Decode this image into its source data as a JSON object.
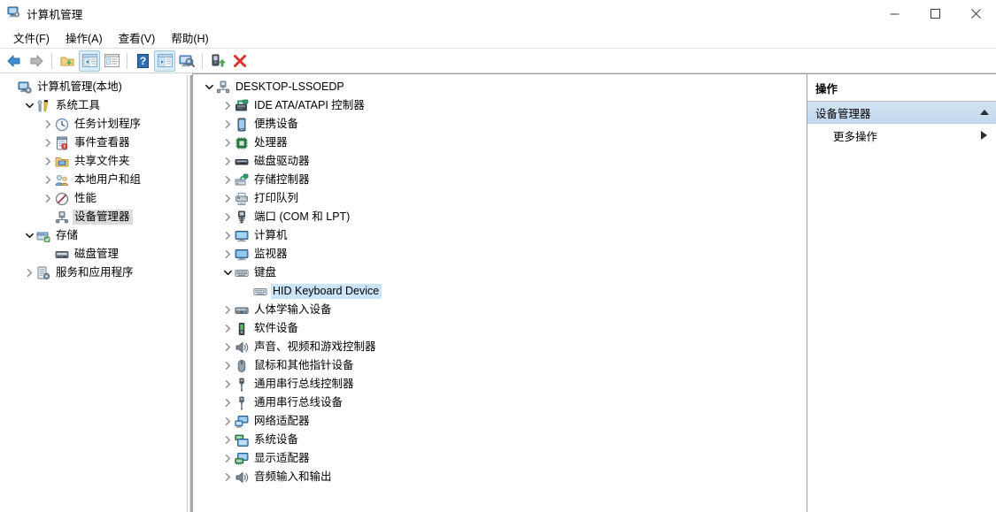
{
  "window": {
    "title": "计算机管理",
    "app_icon": "computer-management-icon",
    "controls": {
      "minimize": "minimize-icon",
      "maximize": "maximize-icon",
      "close": "close-icon"
    }
  },
  "menubar": {
    "items": [
      {
        "label": "文件(F)",
        "name": "menu-file"
      },
      {
        "label": "操作(A)",
        "name": "menu-action"
      },
      {
        "label": "查看(V)",
        "name": "menu-view"
      },
      {
        "label": "帮助(H)",
        "name": "menu-help"
      }
    ]
  },
  "toolbar": {
    "items": [
      {
        "icon": "back-arrow-icon",
        "active": false
      },
      {
        "icon": "forward-arrow-icon",
        "active": false
      },
      {
        "separator": true
      },
      {
        "icon": "up-folder-icon",
        "active": false
      },
      {
        "icon": "show-console-tree-icon",
        "active": true
      },
      {
        "icon": "properties-icon",
        "active": false
      },
      {
        "separator": true
      },
      {
        "icon": "help-icon",
        "active": false
      },
      {
        "icon": "show-action-pane-icon",
        "active": true
      },
      {
        "icon": "scan-hardware-icon",
        "active": false
      },
      {
        "separator": true
      },
      {
        "icon": "update-driver-icon",
        "active": false
      },
      {
        "icon": "uninstall-device-icon",
        "active": false
      }
    ]
  },
  "sidebar": {
    "items": [
      {
        "label": "计算机管理(本地)",
        "icon": "computer-management-icon",
        "indent": 0,
        "chevron": "none",
        "selected": false
      },
      {
        "label": "系统工具",
        "icon": "system-tools-icon",
        "indent": 1,
        "chevron": "expanded",
        "selected": false
      },
      {
        "label": "任务计划程序",
        "icon": "task-scheduler-icon",
        "indent": 2,
        "chevron": "collapsed",
        "selected": false
      },
      {
        "label": "事件查看器",
        "icon": "event-viewer-icon",
        "indent": 2,
        "chevron": "collapsed",
        "selected": false
      },
      {
        "label": "共享文件夹",
        "icon": "shared-folders-icon",
        "indent": 2,
        "chevron": "collapsed",
        "selected": false
      },
      {
        "label": "本地用户和组",
        "icon": "local-users-groups-icon",
        "indent": 2,
        "chevron": "collapsed",
        "selected": false
      },
      {
        "label": "性能",
        "icon": "performance-icon",
        "indent": 2,
        "chevron": "collapsed",
        "selected": false
      },
      {
        "label": "设备管理器",
        "icon": "device-manager-icon",
        "indent": 2,
        "chevron": "none",
        "selected": true
      },
      {
        "label": "存储",
        "icon": "storage-icon",
        "indent": 1,
        "chevron": "expanded",
        "selected": false
      },
      {
        "label": "磁盘管理",
        "icon": "disk-management-icon",
        "indent": 2,
        "chevron": "none",
        "selected": false
      },
      {
        "label": "服务和应用程序",
        "icon": "services-applications-icon",
        "indent": 1,
        "chevron": "collapsed",
        "selected": false
      }
    ]
  },
  "device_tree": {
    "items": [
      {
        "label": "DESKTOP-LSSOEDP",
        "icon": "computer-root-icon",
        "indent": 0,
        "chevron": "expanded",
        "selected": false
      },
      {
        "label": "IDE ATA/ATAPI 控制器",
        "icon": "ide-controller-icon",
        "indent": 1,
        "chevron": "collapsed",
        "selected": false
      },
      {
        "label": "便携设备",
        "icon": "portable-device-icon",
        "indent": 1,
        "chevron": "collapsed",
        "selected": false
      },
      {
        "label": "处理器",
        "icon": "processor-icon",
        "indent": 1,
        "chevron": "collapsed",
        "selected": false
      },
      {
        "label": "磁盘驱动器",
        "icon": "disk-drive-icon",
        "indent": 1,
        "chevron": "collapsed",
        "selected": false
      },
      {
        "label": "存储控制器",
        "icon": "storage-controller-icon",
        "indent": 1,
        "chevron": "collapsed",
        "selected": false
      },
      {
        "label": "打印队列",
        "icon": "print-queue-icon",
        "indent": 1,
        "chevron": "collapsed",
        "selected": false
      },
      {
        "label": "端口 (COM 和 LPT)",
        "icon": "ports-icon",
        "indent": 1,
        "chevron": "collapsed",
        "selected": false
      },
      {
        "label": "计算机",
        "icon": "computer-icon",
        "indent": 1,
        "chevron": "collapsed",
        "selected": false
      },
      {
        "label": "监视器",
        "icon": "monitor-icon",
        "indent": 1,
        "chevron": "collapsed",
        "selected": false
      },
      {
        "label": "键盘",
        "icon": "keyboard-icon",
        "indent": 1,
        "chevron": "expanded",
        "selected": false
      },
      {
        "label": "HID Keyboard Device",
        "icon": "keyboard-device-icon",
        "indent": 2,
        "chevron": "none",
        "selected": true
      },
      {
        "label": "人体学输入设备",
        "icon": "hid-icon",
        "indent": 1,
        "chevron": "collapsed",
        "selected": false
      },
      {
        "label": "软件设备",
        "icon": "software-device-icon",
        "indent": 1,
        "chevron": "collapsed",
        "selected": false
      },
      {
        "label": "声音、视频和游戏控制器",
        "icon": "sound-video-game-icon",
        "indent": 1,
        "chevron": "collapsed",
        "selected": false
      },
      {
        "label": "鼠标和其他指针设备",
        "icon": "mouse-icon",
        "indent": 1,
        "chevron": "collapsed",
        "selected": false
      },
      {
        "label": "通用串行总线控制器",
        "icon": "usb-controller-icon",
        "indent": 1,
        "chevron": "collapsed",
        "selected": false
      },
      {
        "label": "通用串行总线设备",
        "icon": "usb-device-icon",
        "indent": 1,
        "chevron": "collapsed",
        "selected": false
      },
      {
        "label": "网络适配器",
        "icon": "network-adapter-icon",
        "indent": 1,
        "chevron": "collapsed",
        "selected": false
      },
      {
        "label": "系统设备",
        "icon": "system-device-icon",
        "indent": 1,
        "chevron": "collapsed",
        "selected": false
      },
      {
        "label": "显示适配器",
        "icon": "display-adapter-icon",
        "indent": 1,
        "chevron": "collapsed",
        "selected": false
      },
      {
        "label": "音频输入和输出",
        "icon": "audio-io-icon",
        "indent": 1,
        "chevron": "collapsed",
        "selected": false
      }
    ]
  },
  "actions_pane": {
    "title": "操作",
    "section_label": "设备管理器",
    "section_toggle": "collapse-triangle-icon",
    "items": [
      {
        "label": "更多操作",
        "submenu_icon": "submenu-triangle-icon"
      }
    ]
  },
  "colors": {
    "selection_active": "#cce4f7",
    "selection_inactive": "#dcdcdc",
    "action_section_bg": "#c9dcef",
    "toolbar_active": "#d8ecfb",
    "window_bg": "#ffffff"
  }
}
